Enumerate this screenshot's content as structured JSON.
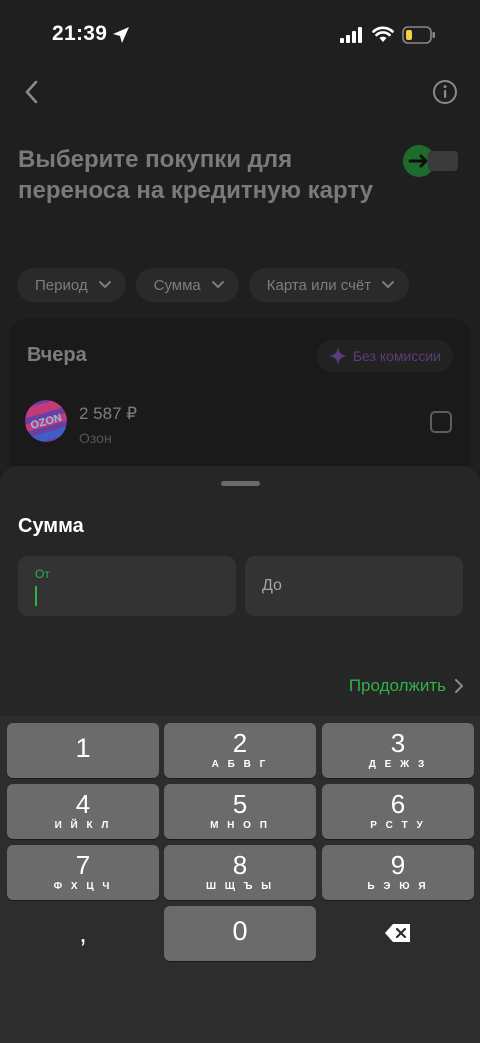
{
  "status_bar": {
    "time": "21:39"
  },
  "header": {
    "title": "Выберите покупки для переноса на кредитную карту"
  },
  "filters": [
    {
      "label": "Период"
    },
    {
      "label": "Сумма"
    },
    {
      "label": "Карта или счёт"
    }
  ],
  "day_group": {
    "title": "Вчера",
    "badge": "Без комиссии",
    "transactions": [
      {
        "amount": "2 587 ₽",
        "merchant": "Озон",
        "logo_text": "OZON"
      }
    ]
  },
  "sheet": {
    "title": "Сумма",
    "from_label": "От",
    "to_placeholder": "До",
    "continue_label": "Продолжить"
  },
  "keypad": {
    "keys": [
      {
        "digit": "1",
        "letters": ""
      },
      {
        "digit": "2",
        "letters": "А Б В Г"
      },
      {
        "digit": "3",
        "letters": "Д Е Ж З"
      },
      {
        "digit": "4",
        "letters": "И Й К Л"
      },
      {
        "digit": "5",
        "letters": "М Н О П"
      },
      {
        "digit": "6",
        "letters": "Р С Т У"
      },
      {
        "digit": "7",
        "letters": "Ф Х Ц Ч"
      },
      {
        "digit": "8",
        "letters": "Ш Щ Ъ Ы"
      },
      {
        "digit": "9",
        "letters": "Ь Э Ю Я"
      },
      {
        "digit": "0",
        "letters": ""
      }
    ],
    "comma": ","
  },
  "colors": {
    "accent_green": "#2fb14a",
    "badge_purple": "#5a3d7a",
    "key_bg": "#6b6b6b",
    "sheet_bg": "#262626"
  }
}
